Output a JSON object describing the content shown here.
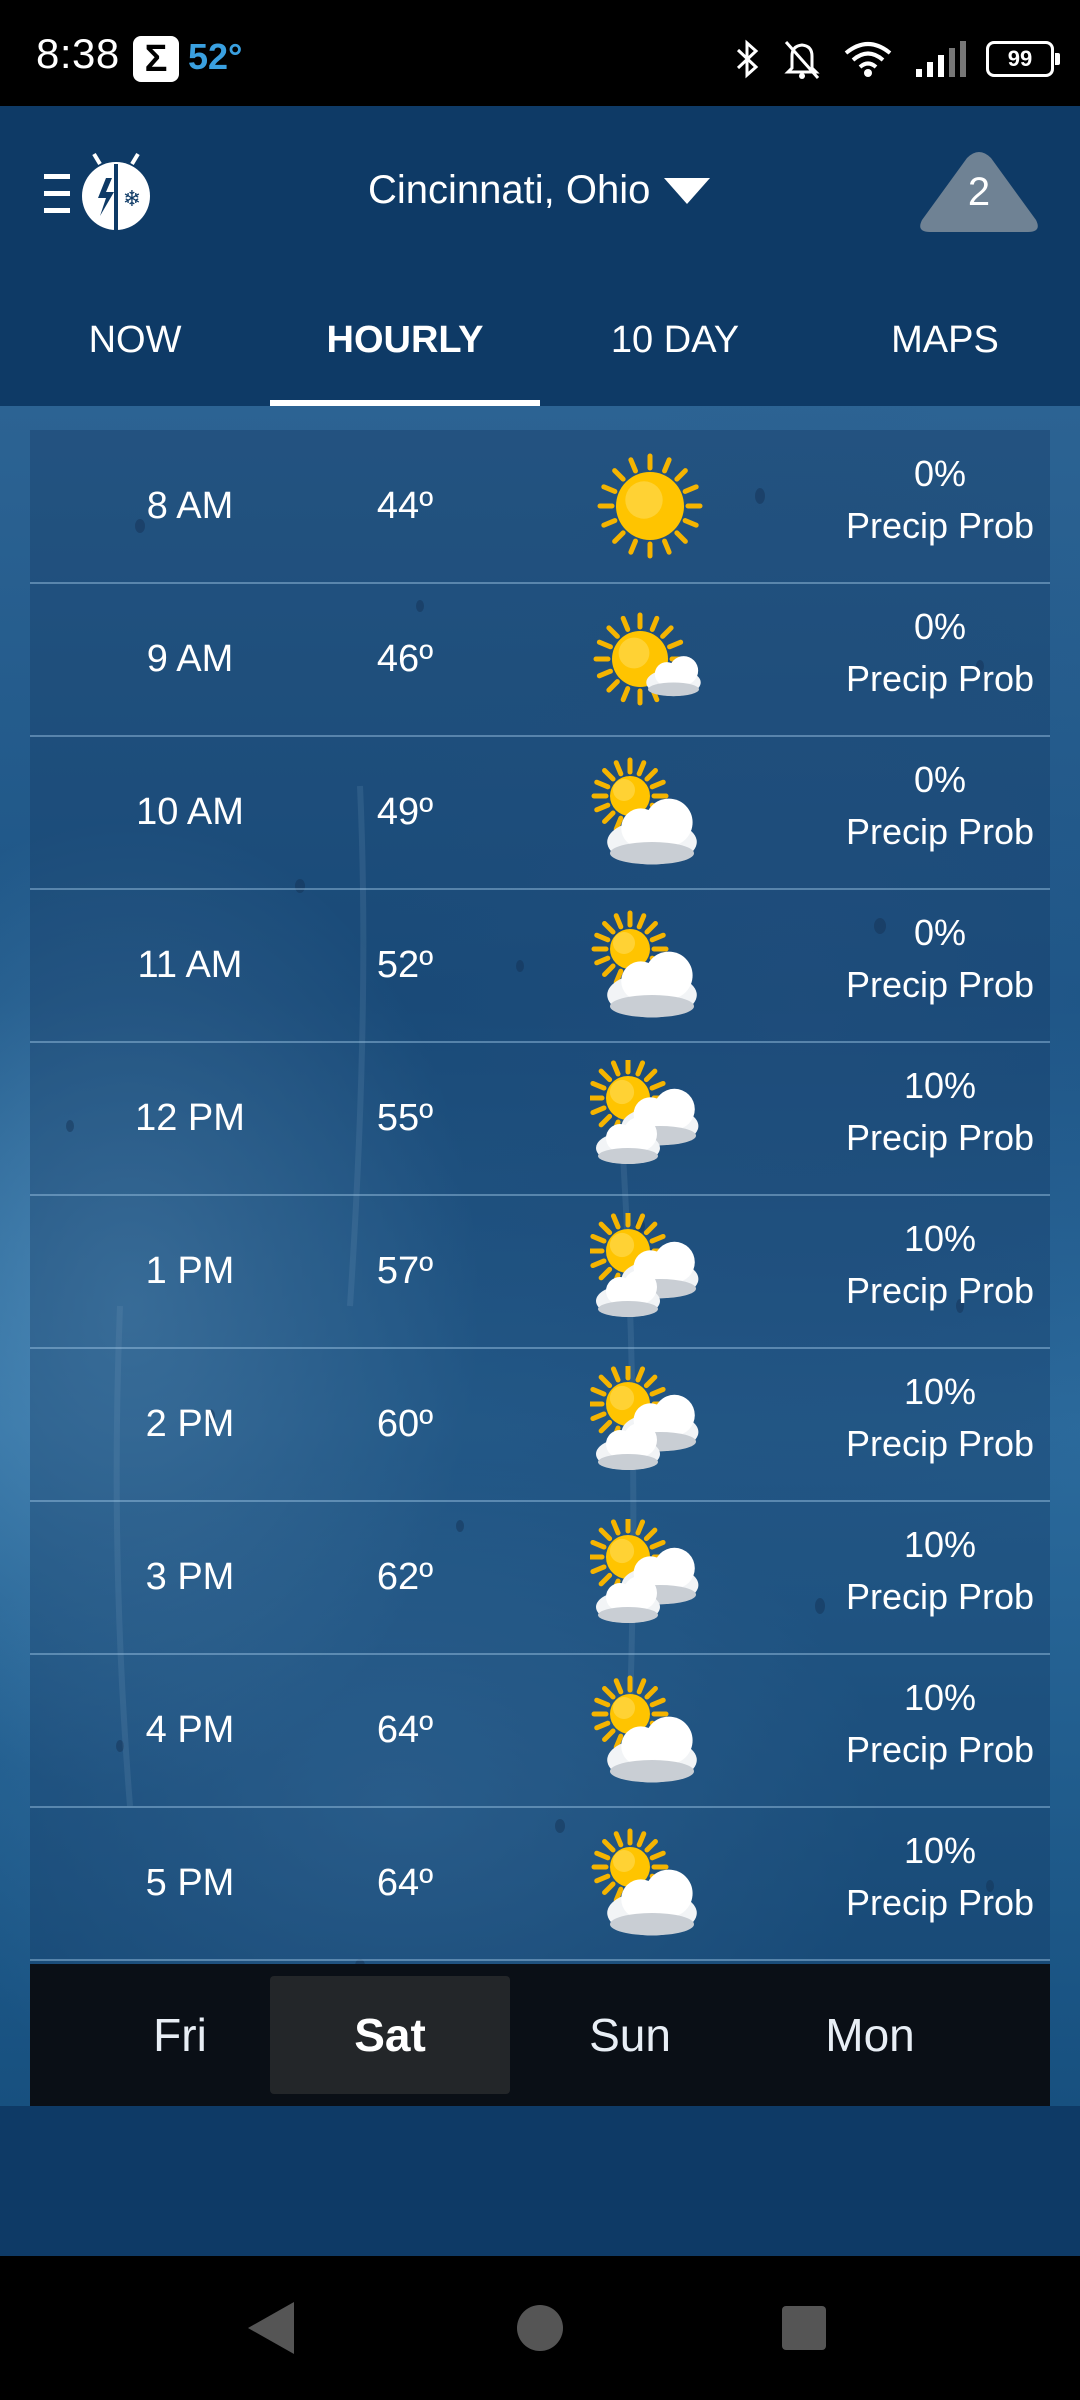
{
  "status_bar": {
    "time": "8:38",
    "notif_symbol": "Σ",
    "temp": "52°",
    "battery": "99",
    "icons": [
      "bluetooth-icon",
      "bell-off-icon",
      "wifi-icon",
      "cell-signal-icon",
      "battery-icon"
    ]
  },
  "header": {
    "location": "Cincinnati, Ohio",
    "alert_count": "2"
  },
  "tabs": [
    {
      "label": "NOW",
      "active": false
    },
    {
      "label": "HOURLY",
      "active": true
    },
    {
      "label": "10 DAY",
      "active": false
    },
    {
      "label": "MAPS",
      "active": false
    }
  ],
  "hourly": [
    {
      "time": "8 AM",
      "temp": "44º",
      "icon": "sunny-icon",
      "precip": "0%",
      "precip_label": "Precip Prob"
    },
    {
      "time": "9 AM",
      "temp": "46º",
      "icon": "mostly-sunny-icon",
      "precip": "0%",
      "precip_label": "Precip Prob"
    },
    {
      "time": "10 AM",
      "temp": "49º",
      "icon": "partly-cloudy-icon",
      "precip": "0%",
      "precip_label": "Precip Prob"
    },
    {
      "time": "11 AM",
      "temp": "52º",
      "icon": "partly-cloudy-icon",
      "precip": "0%",
      "precip_label": "Precip Prob"
    },
    {
      "time": "12 PM",
      "temp": "55º",
      "icon": "mostly-cloudy-icon",
      "precip": "10%",
      "precip_label": "Precip Prob"
    },
    {
      "time": "1 PM",
      "temp": "57º",
      "icon": "mostly-cloudy-icon",
      "precip": "10%",
      "precip_label": "Precip Prob"
    },
    {
      "time": "2 PM",
      "temp": "60º",
      "icon": "mostly-cloudy-icon",
      "precip": "10%",
      "precip_label": "Precip Prob"
    },
    {
      "time": "3 PM",
      "temp": "62º",
      "icon": "mostly-cloudy-icon",
      "precip": "10%",
      "precip_label": "Precip Prob"
    },
    {
      "time": "4 PM",
      "temp": "64º",
      "icon": "partly-cloudy-icon",
      "precip": "10%",
      "precip_label": "Precip Prob"
    },
    {
      "time": "5 PM",
      "temp": "64º",
      "icon": "partly-cloudy-icon",
      "precip": "10%",
      "precip_label": "Precip Prob"
    }
  ],
  "days": [
    {
      "label": "Fri",
      "active": false
    },
    {
      "label": "Sat",
      "active": true
    },
    {
      "label": "Sun",
      "active": false
    },
    {
      "label": "Mon",
      "active": false
    }
  ],
  "colors": {
    "header_bg": "#0e3a66",
    "status_temp": "#3aa0e0",
    "sun": "#f5b400"
  }
}
